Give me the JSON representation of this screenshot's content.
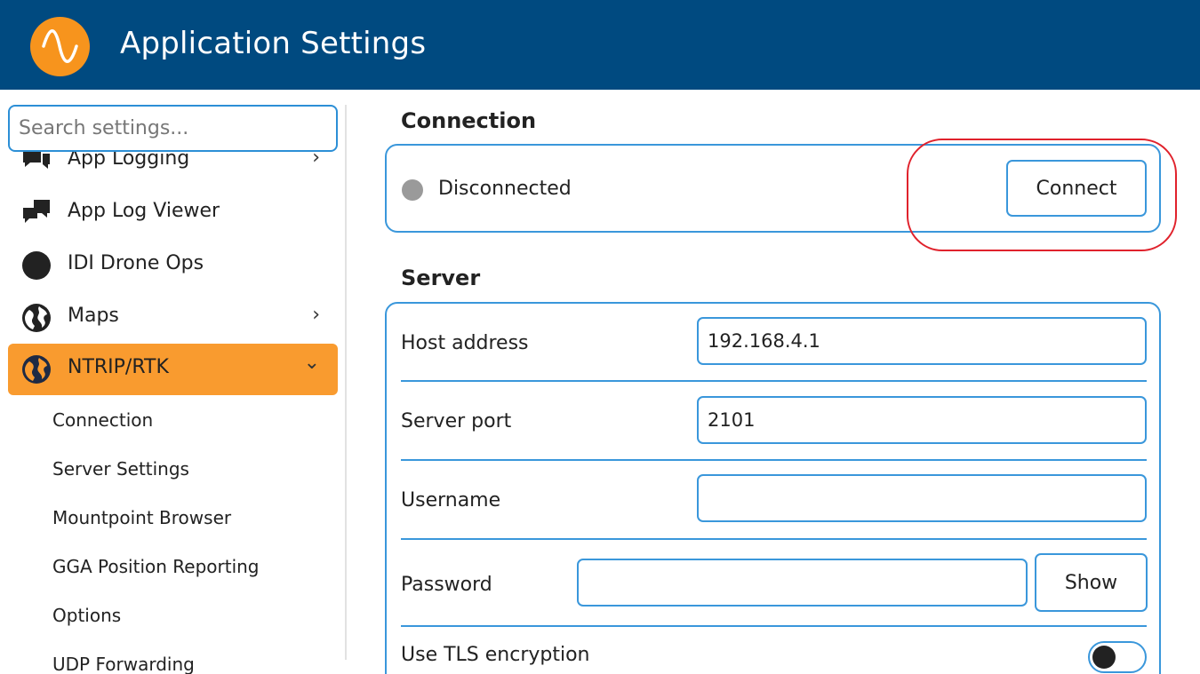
{
  "header": {
    "title": "Application Settings",
    "logo_icon": "sine-wave-icon"
  },
  "search": {
    "placeholder": "Search settings..."
  },
  "sidebar": {
    "items": [
      {
        "label": "App Logging",
        "icon": "chat-bubbles-icon",
        "chevron": "›"
      },
      {
        "label": "App Log Viewer",
        "icon": "chat-bubbles-icon"
      },
      {
        "label": "IDI Drone Ops",
        "icon": "circle-icon"
      },
      {
        "label": "Maps",
        "icon": "globe-icon",
        "chevron": "›"
      },
      {
        "label": "NTRIP/RTK",
        "icon": "globe-icon",
        "chevron": "⌄",
        "active": true
      }
    ],
    "subitems": [
      "Connection",
      "Server Settings",
      "Mountpoint Browser",
      "GGA Position Reporting",
      "Options",
      "UDP Forwarding"
    ]
  },
  "connection": {
    "title": "Connection",
    "status": "Disconnected",
    "status_color": "#9a9a9a",
    "button": "Connect"
  },
  "server": {
    "title": "Server",
    "host_label": "Host address",
    "host_value": "192.168.4.1",
    "port_label": "Server port",
    "port_value": "2101",
    "username_label": "Username",
    "username_value": "",
    "password_label": "Password",
    "password_value": "",
    "show_button": "Show",
    "tls_label": "Use TLS encryption",
    "tls_enabled": false
  },
  "colors": {
    "header": "#004a80",
    "accent": "#f99b2f",
    "border": "#3a97db",
    "highlight": "#e0222c"
  }
}
